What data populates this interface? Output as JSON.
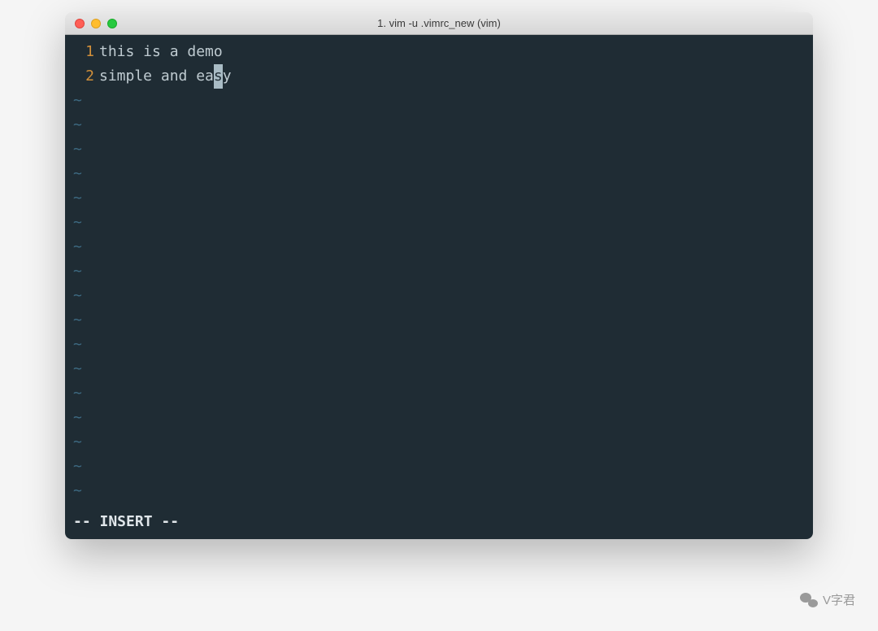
{
  "window": {
    "title": "1. vim -u .vimrc_new (vim)"
  },
  "editor": {
    "lines": [
      {
        "num": "1",
        "text": "this is a demo"
      },
      {
        "num": "2",
        "before_cursor": "simple and ea",
        "cursor_char": "s",
        "after_cursor": "y"
      }
    ],
    "tilde": "~",
    "empty_rows": 17
  },
  "status": {
    "mode": "-- INSERT --"
  },
  "watermark": {
    "label": "V字君"
  },
  "colors": {
    "bg": "#1f2c34",
    "fg": "#bfcbd1",
    "line_number": "#d08f3a",
    "tilde": "#3d6a82"
  }
}
